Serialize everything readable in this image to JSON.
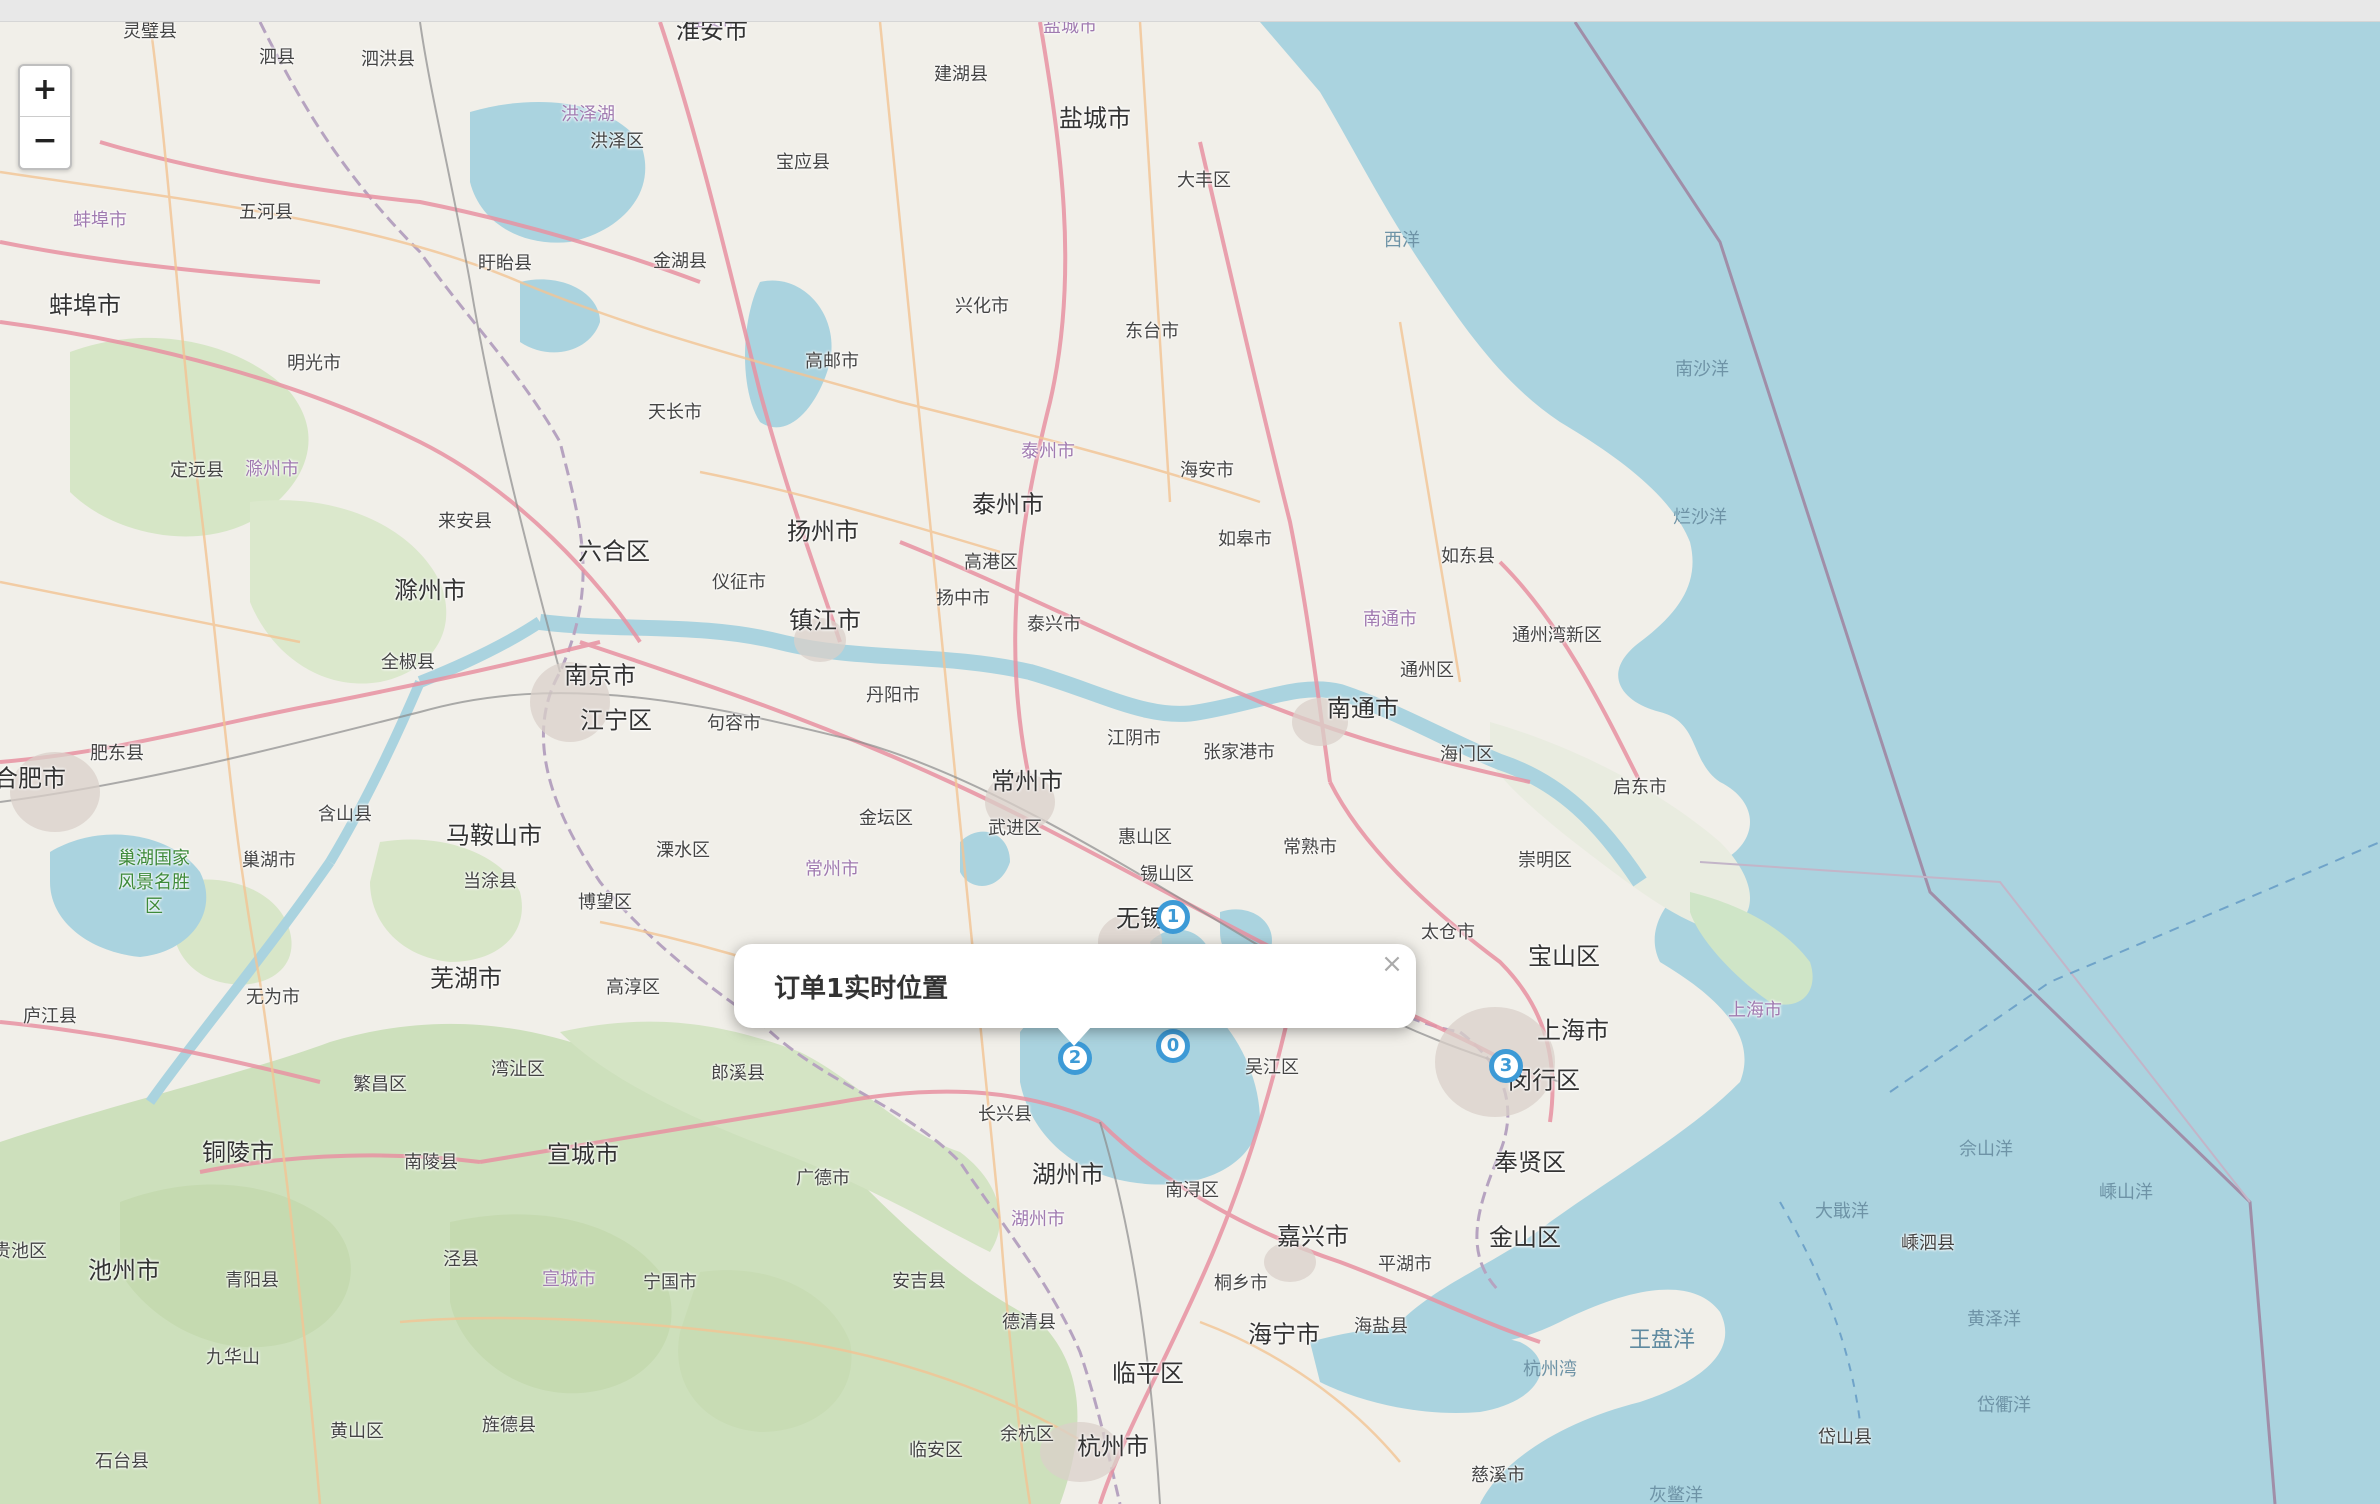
{
  "zoom": {
    "in_label": "+",
    "out_label": "−"
  },
  "popup": {
    "title": "订单1实时位置",
    "close_label": "×"
  },
  "markers": [
    {
      "label": "1"
    },
    {
      "label": "0"
    },
    {
      "label": "2"
    },
    {
      "label": "3"
    }
  ],
  "labels": {
    "cities": [
      "淮安市",
      "盐城市",
      "蚌埠市",
      "泰州市",
      "扬州市",
      "六合区",
      "滁州市",
      "镇江市",
      "南京市",
      "江宁区",
      "合肥市",
      "马鞍山市",
      "常州市",
      "无锡",
      "南通市",
      "宝山区",
      "上海市",
      "闵行区",
      "芜湖市",
      "铜陵市",
      "宣城市",
      "池州市",
      "湖州市",
      "嘉兴市",
      "奉贤区",
      "金山区",
      "海宁市",
      "临平区",
      "杭州市"
    ],
    "towns": [
      "灵璧县",
      "泗县",
      "泗洪县",
      "洪泽区",
      "建湖县",
      "宝应县",
      "大丰区",
      "五河县",
      "盱眙县",
      "金湖县",
      "兴化市",
      "东台市",
      "明光市",
      "高邮市",
      "天长市",
      "定远县",
      "海安市",
      "来安县",
      "如皋市",
      "如东县",
      "仪征市",
      "高港区",
      "扬中市",
      "泰兴市",
      "全椒县",
      "通州湾新区",
      "通州区",
      "丹阳市",
      "句容市",
      "江阴市",
      "张家港市",
      "海门区",
      "启东市",
      "肥东县",
      "含山县",
      "金坛区",
      "武进区",
      "惠山区",
      "常熟市",
      "巢湖市",
      "当涂县",
      "溧水区",
      "锡山区",
      "崇明区",
      "博望区",
      "太仓市",
      "庐江县",
      "无为市",
      "高淳区",
      "繁昌区",
      "湾沚区",
      "郎溪县",
      "长兴县",
      "吴江区",
      "南陵县",
      "广德市",
      "南浔区",
      "平湖市",
      "贵池区",
      "青阳县",
      "泾县",
      "宁国市",
      "安吉县",
      "桐乡市",
      "德清县",
      "海盐县",
      "九华山",
      "黄山区",
      "旌德县",
      "余杭区",
      "临安区",
      "石台县",
      "慈溪市",
      "岱山县",
      "嵊泗县"
    ],
    "regions": [
      "淮安市",
      "洪泽湖",
      "盐城市",
      "蚌埠市",
      "滁州市",
      "泰州市",
      "南通市",
      "常州市",
      "宣城市",
      "湖州市"
    ],
    "seas": [
      "西洋",
      "南沙洋",
      "烂沙洋",
      "上海市",
      "佘山洋",
      "嵊山洋",
      "大戢洋",
      "黄泽洋",
      "岱衢洋",
      "灰鳖洋",
      "杭州湾",
      "王盘洋"
    ],
    "park": "巢湖国家\n风景名胜\n区"
  }
}
